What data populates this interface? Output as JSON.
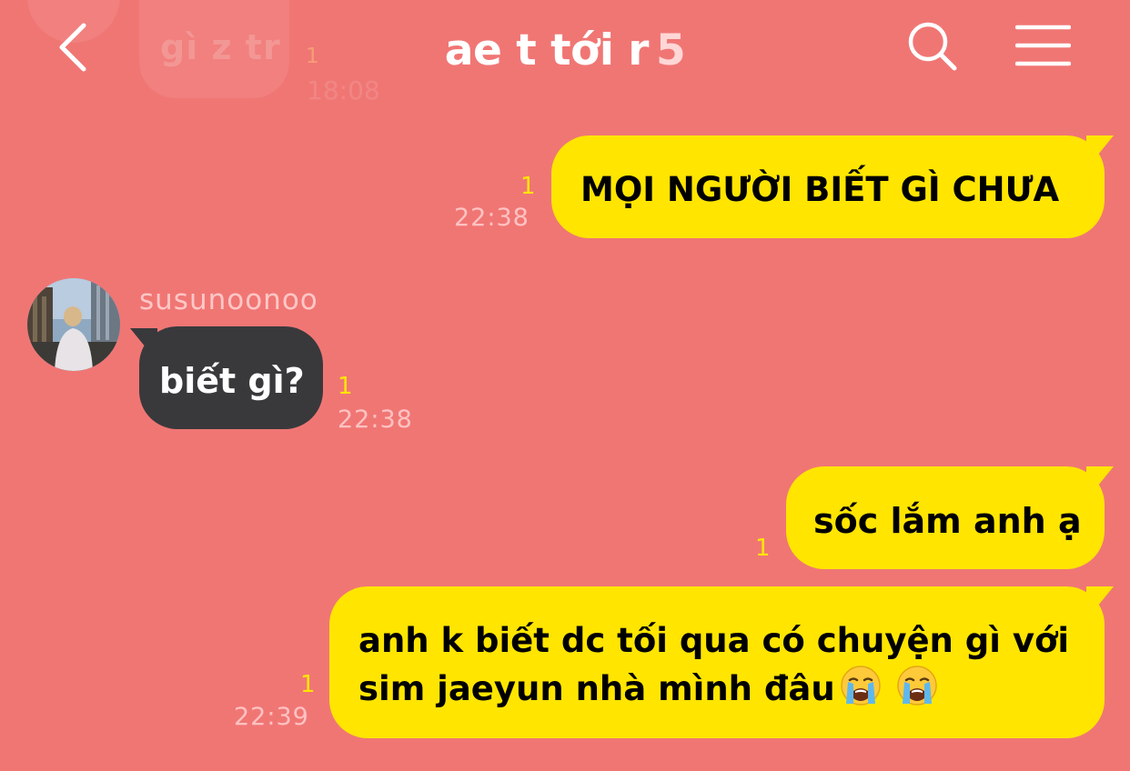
{
  "previous_message": {
    "text": "gì z tr",
    "unread": "1",
    "time": "18:08"
  },
  "header": {
    "title": "ae t tới r",
    "member_count": "5",
    "back_icon": "chevron-left-icon",
    "search_icon": "search-icon",
    "menu_icon": "hamburger-menu-icon"
  },
  "messages": [
    {
      "direction": "outgoing",
      "text": "MỌI NGƯỜI BIẾT GÌ CHƯA",
      "unread": "1",
      "time": "22:38"
    },
    {
      "direction": "incoming",
      "sender": "susunoonoo",
      "text": "biết gì?",
      "unread": "1",
      "time": "22:38"
    },
    {
      "direction": "outgoing",
      "text": "sốc lắm anh ạ",
      "unread": "1"
    },
    {
      "direction": "outgoing",
      "line1": "anh k biết dc tối qua có chuyện gì với",
      "line2": "sim jaeyun nhà mình đâu",
      "emojis": [
        "loudly-crying-face",
        "loudly-crying-face"
      ],
      "unread": "1",
      "time": "22:39"
    }
  ],
  "colors": {
    "background": "#f07674",
    "outgoing_bubble": "#ffe500",
    "incoming_bubble": "#39393c",
    "unread": "#ffe500",
    "timestamp": "#ffc2c2"
  }
}
